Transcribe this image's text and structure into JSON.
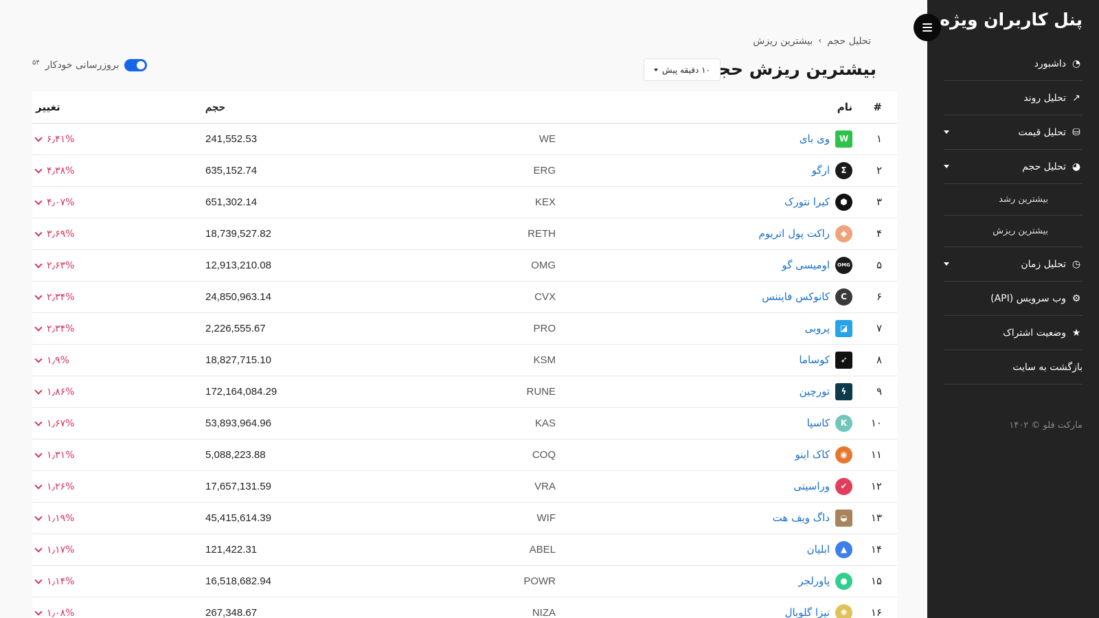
{
  "sidebar": {
    "title": "پنل کاربران ویژه",
    "items": [
      {
        "label": "داشبورد",
        "icon": "dashboard-gauge-icon",
        "glyph": "◔",
        "caret": false
      },
      {
        "label": "تحلیل روند",
        "icon": "trend-line-icon",
        "glyph": "↗",
        "caret": false
      },
      {
        "label": "تحلیل قیمت",
        "icon": "coins-icon",
        "glyph": "⛁",
        "caret": true
      },
      {
        "label": "تحلیل حجم",
        "icon": "pie-chart-icon",
        "glyph": "◕",
        "caret": true
      }
    ],
    "subitems": [
      {
        "label": "بیشترین رشد"
      },
      {
        "label": "بیشترین ریزش"
      }
    ],
    "items_after": [
      {
        "label": "تحلیل زمان",
        "icon": "clock-icon",
        "glyph": "◷",
        "caret": true
      },
      {
        "label": "وب سرویس (API)",
        "icon": "gears-icon",
        "glyph": "⚙",
        "caret": false
      },
      {
        "label": "وضعیت اشتراک",
        "icon": "star-icon",
        "glyph": "★",
        "caret": false
      },
      {
        "label": "بازگشت به سایت",
        "icon": "",
        "glyph": "",
        "caret": false
      }
    ],
    "footer": "مارکت فلو © ۱۴۰۲"
  },
  "breadcrumb": {
    "parent": "تحلیل حجم",
    "separator": "›",
    "current": "بیشترین ریزش"
  },
  "page_title": "بیشترین ریزش حجم",
  "time_dropdown": {
    "selected": "۱۰ دقیقه پیش"
  },
  "auto_update": {
    "label": "بروزرسانی خودکار",
    "counter": "۵۴",
    "enabled": true
  },
  "table": {
    "headers": {
      "index": "#",
      "name": "نام",
      "volume": "حجم",
      "change": "تغییر"
    },
    "rows": [
      {
        "index": "۱",
        "name": "وی بای",
        "symbol": "WE",
        "volume": "241,552.53",
        "change": "۶٫۴۱%",
        "icon": "we-coin-icon",
        "color": "#2ec24a",
        "glyph": "W",
        "square": true
      },
      {
        "index": "۲",
        "name": "ارگو",
        "symbol": "ERG",
        "volume": "635,152.74",
        "change": "۴٫۳۸%",
        "icon": "erg-coin-icon",
        "color": "#1a1a1a",
        "glyph": "Σ",
        "square": false
      },
      {
        "index": "۳",
        "name": "کیرا نتورک",
        "symbol": "KEX",
        "volume": "651,302.14",
        "change": "۴٫۰۷%",
        "icon": "kex-coin-icon",
        "color": "#111111",
        "glyph": "⬢",
        "square": false
      },
      {
        "index": "۴",
        "name": "راکت پول اتریوم",
        "symbol": "RETH",
        "volume": "18,739,527.82",
        "change": "۳٫۶۹%",
        "icon": "reth-coin-icon",
        "color": "#f0a27a",
        "glyph": "◆",
        "square": false
      },
      {
        "index": "۵",
        "name": "اومیسی گو",
        "symbol": "OMG",
        "volume": "12,913,210.08",
        "change": "۲٫۶۳%",
        "icon": "omg-coin-icon",
        "color": "#1a1a1a",
        "glyph": "OMG",
        "square": false
      },
      {
        "index": "۶",
        "name": "کانوکس فایننس",
        "symbol": "CVX",
        "volume": "24,850,963.14",
        "change": "۲٫۳۴%",
        "icon": "cvx-coin-icon",
        "color": "#3a3a3a",
        "glyph": "C",
        "square": false
      },
      {
        "index": "۷",
        "name": "پروبی",
        "symbol": "PRO",
        "volume": "2,226,555.67",
        "change": "۲٫۳۴%",
        "icon": "pro-coin-icon",
        "color": "#27a3e8",
        "glyph": "◪",
        "square": true
      },
      {
        "index": "۸",
        "name": "کوساما",
        "symbol": "KSM",
        "volume": "18,827,715.10",
        "change": "۱٫۹%",
        "icon": "ksm-coin-icon",
        "color": "#111111",
        "glyph": "➶",
        "square": true
      },
      {
        "index": "۹",
        "name": "تورچین",
        "symbol": "RUNE",
        "volume": "172,164,084.29",
        "change": "۱٫۸۶%",
        "icon": "rune-coin-icon",
        "color": "#0d3b4a",
        "glyph": "ϟ",
        "square": true
      },
      {
        "index": "۱۰",
        "name": "کاسپا",
        "symbol": "KAS",
        "volume": "53,893,964.96",
        "change": "۱٫۶۷%",
        "icon": "kas-coin-icon",
        "color": "#70c7ba",
        "glyph": "K",
        "square": false
      },
      {
        "index": "۱۱",
        "name": "کاک اینو",
        "symbol": "COQ",
        "volume": "5,088,223.88",
        "change": "۱٫۳۱%",
        "icon": "coq-coin-icon",
        "color": "#e8772e",
        "glyph": "◉",
        "square": false
      },
      {
        "index": "۱۲",
        "name": "وراسیتی",
        "symbol": "VRA",
        "volume": "17,657,131.59",
        "change": "۱٫۲۶%",
        "icon": "vra-coin-icon",
        "color": "#e23d5b",
        "glyph": "✔",
        "square": false
      },
      {
        "index": "۱۳",
        "name": "داگ ویف هت",
        "symbol": "WIF",
        "volume": "45,415,614.39",
        "change": "۱٫۱۹%",
        "icon": "wif-coin-icon",
        "color": "#a8845c",
        "glyph": "◒",
        "square": true
      },
      {
        "index": "۱۴",
        "name": "ابلیان",
        "symbol": "ABEL",
        "volume": "121,422.31",
        "change": "۱٫۱۷%",
        "icon": "abel-coin-icon",
        "color": "#3d7ee8",
        "glyph": "▲",
        "square": false
      },
      {
        "index": "۱۵",
        "name": "پاورلجر",
        "symbol": "POWR",
        "volume": "16,518,682.94",
        "change": "۱٫۱۴%",
        "icon": "powr-coin-icon",
        "color": "#2fd08e",
        "glyph": "●",
        "square": false
      },
      {
        "index": "۱۶",
        "name": "نیزا گلوبال",
        "symbol": "NIZA",
        "volume": "267,348.67",
        "change": "۱٫۰۸%",
        "icon": "niza-coin-icon",
        "color": "#e0c25a",
        "glyph": "✺",
        "square": false
      }
    ]
  }
}
